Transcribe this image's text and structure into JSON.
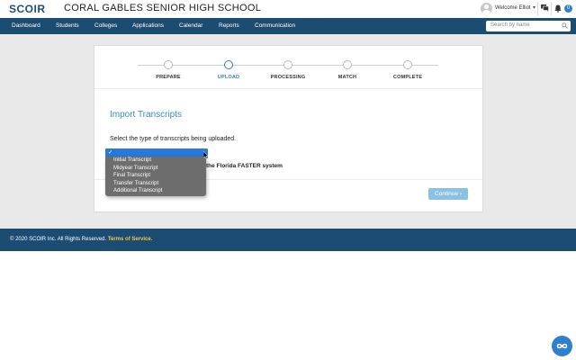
{
  "header": {
    "logo": "SCOIR",
    "school_name": "CORAL GABLES SENIOR HIGH SCHOOL",
    "welcome": "Welcome Elliot",
    "notification_count": "0"
  },
  "nav": {
    "items": [
      "Dashboard",
      "Students",
      "Colleges",
      "Applications",
      "Calendar",
      "Reports",
      "Communication"
    ],
    "search_placeholder": "Search by name"
  },
  "stepper": {
    "steps": [
      {
        "label": "PREPARE",
        "active": false
      },
      {
        "label": "UPLOAD",
        "active": true
      },
      {
        "label": "PROCESSING",
        "active": false
      },
      {
        "label": "MATCH",
        "active": false
      },
      {
        "label": "COMPLETE",
        "active": false
      }
    ]
  },
  "main": {
    "title": "Import Transcripts",
    "instruction": "Select the type of transcripts being uploaded.",
    "selected_check": "✓",
    "florida_text": "the Florida FASTER system",
    "continue_label": "Continue ›"
  },
  "dropdown": {
    "options": [
      "Initial Transcript",
      "Midyear Transcript",
      "Final Transcript",
      "Transfer Transcript",
      "Additional Transcript"
    ]
  },
  "footer": {
    "copyright": "© 2020 SCOIR Inc. All Rights Reserved.",
    "terms": "Terms of Service."
  },
  "colors": {
    "nav_bg": "#1d4c72",
    "accent": "#2f7fb8",
    "select_highlight": "#2879d9",
    "footer_link": "#f2c744"
  }
}
